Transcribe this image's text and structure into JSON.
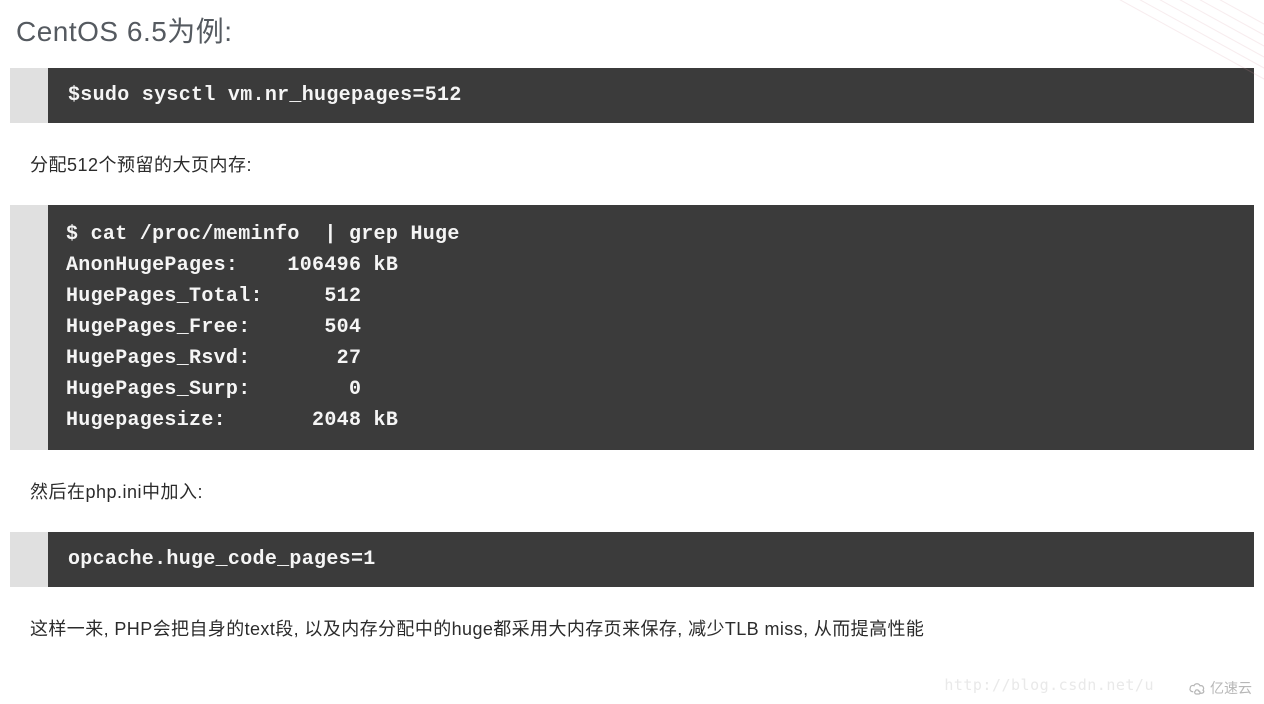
{
  "heading": "CentOS 6.5为例:",
  "code_block_1": "$sudo sysctl vm.nr_hugepages=512",
  "para_1": "分配512个预留的大页内存:",
  "code_block_2": "$ cat /proc/meminfo  | grep Huge\nAnonHugePages:    106496 kB\nHugePages_Total:     512\nHugePages_Free:      504\nHugePages_Rsvd:       27\nHugePages_Surp:        0\nHugepagesize:       2048 kB",
  "para_2": "然后在php.ini中加入:",
  "code_block_3": "opcache.huge_code_pages=1",
  "para_3": "这样一来, PHP会把自身的text段, 以及内存分配中的huge都采用大内存页来保存, 减少TLB miss, 从而提高性能",
  "watermark_url": "http://blog.csdn.net/u",
  "watermark_brand": "亿速云"
}
